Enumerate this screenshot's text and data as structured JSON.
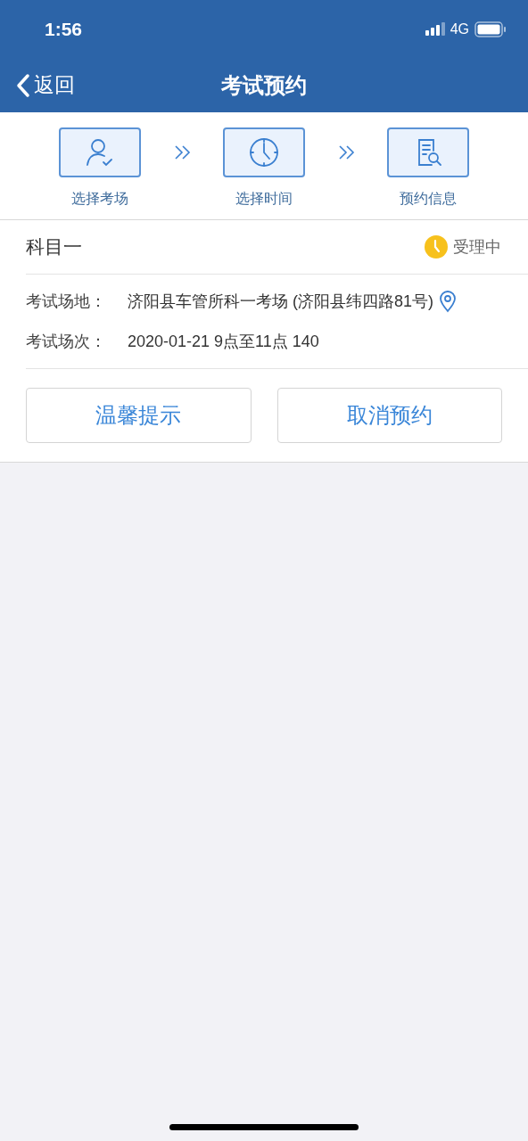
{
  "status_bar": {
    "time": "1:56",
    "network": "4G"
  },
  "nav": {
    "back": "返回",
    "title": "考试预约"
  },
  "steps": [
    {
      "kind": "person",
      "label": "选择考场"
    },
    {
      "kind": "clock",
      "label": "选择时间"
    },
    {
      "kind": "document",
      "label": "预约信息"
    }
  ],
  "booking": {
    "subject": "科目一",
    "status": "受理中",
    "details": [
      {
        "label": "考试场地：",
        "value": "济阳县车管所科一考场 (济阳县纬四路81号)",
        "kind": "location"
      },
      {
        "label": "考试场次：",
        "value": "2020-01-21 9点至11点 140",
        "kind": "plain"
      }
    ],
    "buttons": [
      "温馨提示",
      "取消预约"
    ]
  }
}
